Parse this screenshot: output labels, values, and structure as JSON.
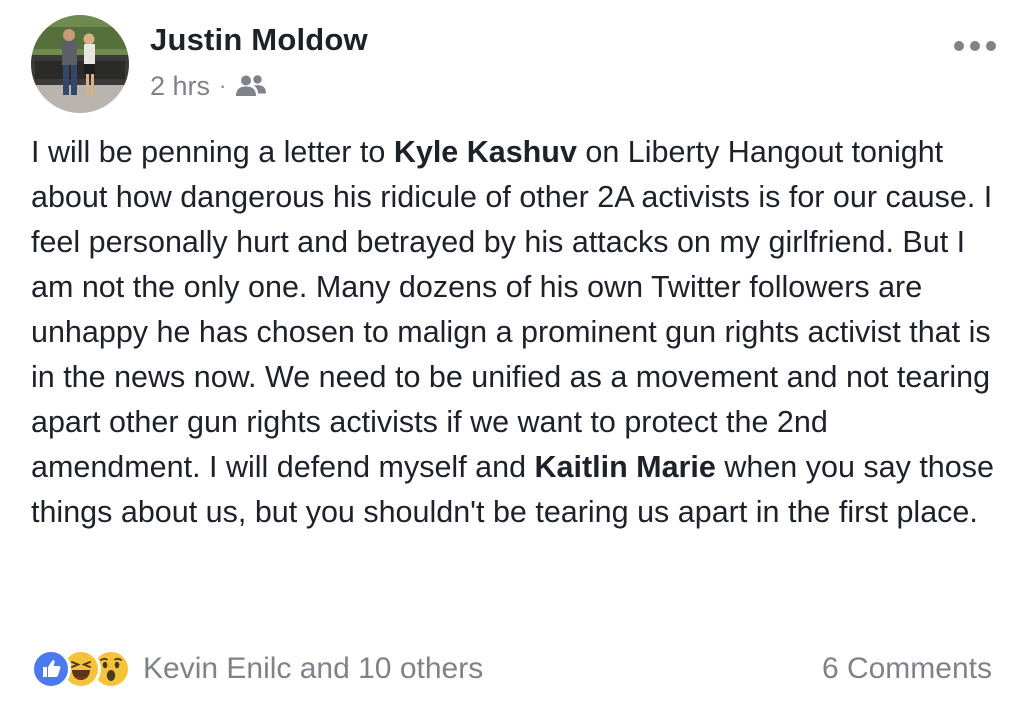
{
  "post": {
    "author": "Justin Moldow",
    "timestamp": "2 hrs",
    "separator": "·",
    "audience_icon": "friends-icon",
    "text": {
      "p1": "I will be penning a letter to ",
      "mention1": "Kyle Kashuv",
      "p2": " on Liberty Hangout tonight about how dangerous his ridicule of other 2A activists is for our cause. I feel personally hurt and betrayed by his attacks on my girlfriend. But I am not the only one. Many dozens of his own Twitter followers are unhappy he has chosen to malign a prominent gun rights activist that is in the news now. We need to be unified as a movement and not tearing apart other gun rights activists if we want to protect the 2nd amendment. I will defend myself and ",
      "mention2": "Kaitlin Marie",
      "p3": " when you say those things about us, but you shouldn't be tearing us apart in the first place."
    },
    "reactions": {
      "icons": [
        "like-icon",
        "haha-icon",
        "wow-icon"
      ],
      "summary": "Kevin Enilc and 10 others"
    },
    "comments_label": "6 Comments"
  },
  "colors": {
    "text_primary": "#1d2129",
    "text_secondary": "#7f8289",
    "like_blue": "#4a7aed",
    "emoji_yellow": "#f5c33b"
  }
}
